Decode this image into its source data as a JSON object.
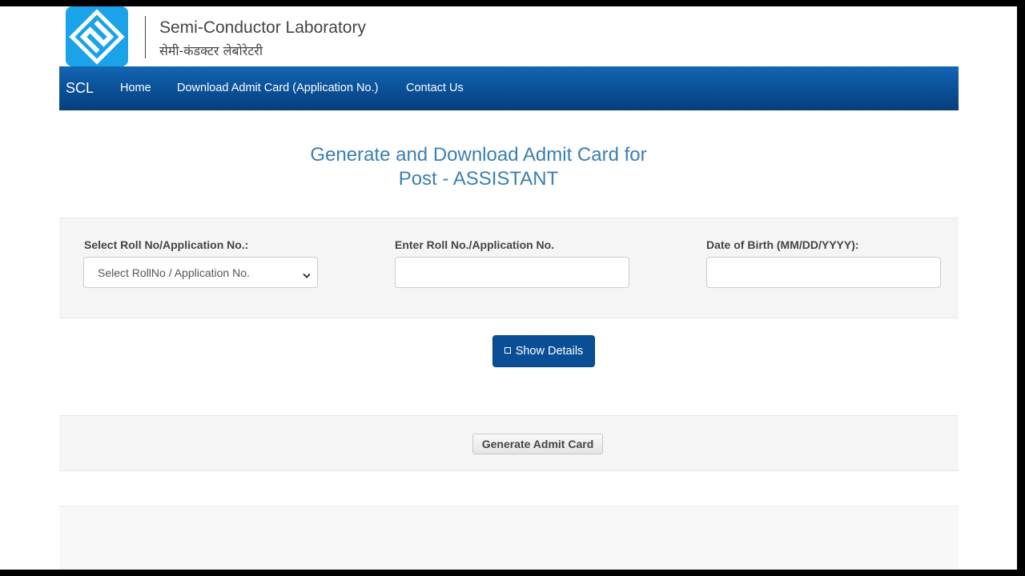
{
  "header": {
    "org_name_en": "Semi-Conductor Laboratory",
    "org_name_hi": "सेमी-कंडक्टर लेबोरेटरी",
    "logo_icon": "scl-logo-icon",
    "logo_color": "#1aa3e8"
  },
  "nav": {
    "brand": "SCL",
    "links": [
      "Home",
      "Download Admit Card (Application No.)",
      "Contact Us"
    ],
    "bg_color": "#0a4f96"
  },
  "title": {
    "line1": "Generate and Download Admit Card for",
    "line2": "Post - ASSISTANT",
    "color": "#3a7fb3"
  },
  "form": {
    "select_label": "Select Roll No/Application No.:",
    "select_value": "Select RollNo / Application No.",
    "roll_label": "Enter Roll No./Application No.",
    "roll_value": "",
    "dob_label": "Date of Birth (MM/DD/YYYY):",
    "dob_value": ""
  },
  "buttons": {
    "show_details": "Show Details",
    "generate": "Generate Admit Card"
  }
}
